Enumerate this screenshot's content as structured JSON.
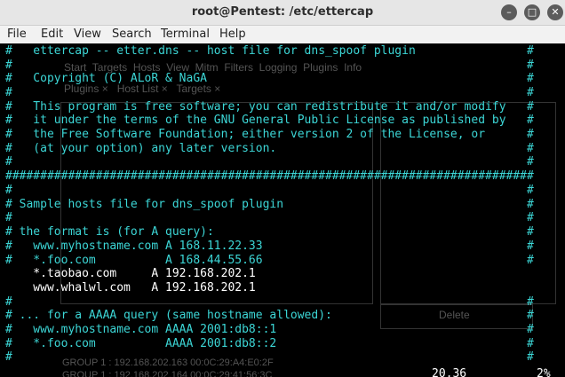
{
  "window": {
    "title": "root@Pentest: /etc/ettercap"
  },
  "menu": [
    "File",
    "Edit",
    "View",
    "Search",
    "Terminal",
    "Help"
  ],
  "background_app": {
    "menu": [
      "Start",
      "Targets",
      "Hosts",
      "View",
      "Mitm",
      "Filters",
      "Logging",
      "Plugins",
      "Info"
    ],
    "tabs": [
      "Plugins ×",
      "Host List ×",
      "Targets ×"
    ],
    "delete_button": "Delete",
    "log_lines": [
      "GROUP 1 : 192.168.202.163 00:0C:29:A4:E0:2F",
      "GROUP 1 : 192.168.202.164 00:0C:29:41:56:3C"
    ]
  },
  "terminal": {
    "lines": [
      {
        "text": "#   ettercap -- etter.dns -- host file for dns_spoof plugin                #",
        "color": "cyan"
      },
      {
        "text": "#                                                                          #",
        "color": "cyan"
      },
      {
        "text": "#   Copyright (C) ALoR & NaGA                                              #",
        "color": "cyan"
      },
      {
        "text": "#                                                                          #",
        "color": "cyan"
      },
      {
        "text": "#   This program is free software; you can redistribute it and/or modify   #",
        "color": "cyan"
      },
      {
        "text": "#   it under the terms of the GNU General Public License as published by   #",
        "color": "cyan"
      },
      {
        "text": "#   the Free Software Foundation; either version 2 of the License, or      #",
        "color": "cyan"
      },
      {
        "text": "#   (at your option) any later version.                                    #",
        "color": "cyan"
      },
      {
        "text": "#                                                                          #",
        "color": "cyan"
      },
      {
        "text": "############################################################################",
        "color": "cyan"
      },
      {
        "text": "#                                                                          #",
        "color": "cyan"
      },
      {
        "text": "# Sample hosts file for dns_spoof plugin                                   #",
        "color": "cyan"
      },
      {
        "text": "#                                                                          #",
        "color": "cyan"
      },
      {
        "text": "# the format is (for A query):                                             #",
        "color": "cyan"
      },
      {
        "text": "#   www.myhostname.com A 168.11.22.33                                      #",
        "color": "cyan"
      },
      {
        "text": "#   *.foo.com          A 168.44.55.66                                      #",
        "color": "cyan"
      },
      {
        "text": "    *.taobao.com     A 192.168.202.1",
        "color": "white"
      },
      {
        "text": "    www.whalwl.com   A 192.168.202.1",
        "color": "white"
      },
      {
        "text": "#                                                                          #",
        "color": "cyan"
      },
      {
        "text": "# ... for a AAAA query (same hostname allowed):                            #",
        "color": "cyan"
      },
      {
        "text": "#   www.myhostname.com AAAA 2001:db8::1                                    #",
        "color": "cyan"
      },
      {
        "text": "#   *.foo.com          AAAA 2001:db8::2                                    #",
        "color": "cyan"
      },
      {
        "text": "#                                                                          #",
        "color": "cyan"
      }
    ],
    "status_position": "20,36",
    "status_percent": "2%"
  }
}
